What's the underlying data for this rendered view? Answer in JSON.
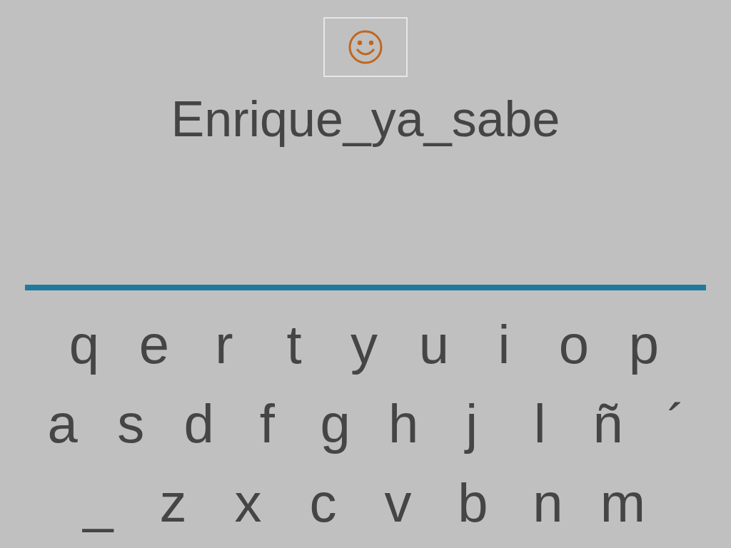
{
  "title": "Enrique_ya_sabe",
  "keyboard": {
    "rows": [
      [
        "q",
        "e",
        "r",
        "t",
        "y",
        "u",
        "i",
        "o",
        "p"
      ],
      [
        "a",
        "s",
        "d",
        "f",
        "g",
        "h",
        "j",
        "l",
        "ñ",
        "´"
      ],
      [
        "_",
        "z",
        "x",
        "c",
        "v",
        "b",
        "n",
        "m"
      ]
    ]
  }
}
